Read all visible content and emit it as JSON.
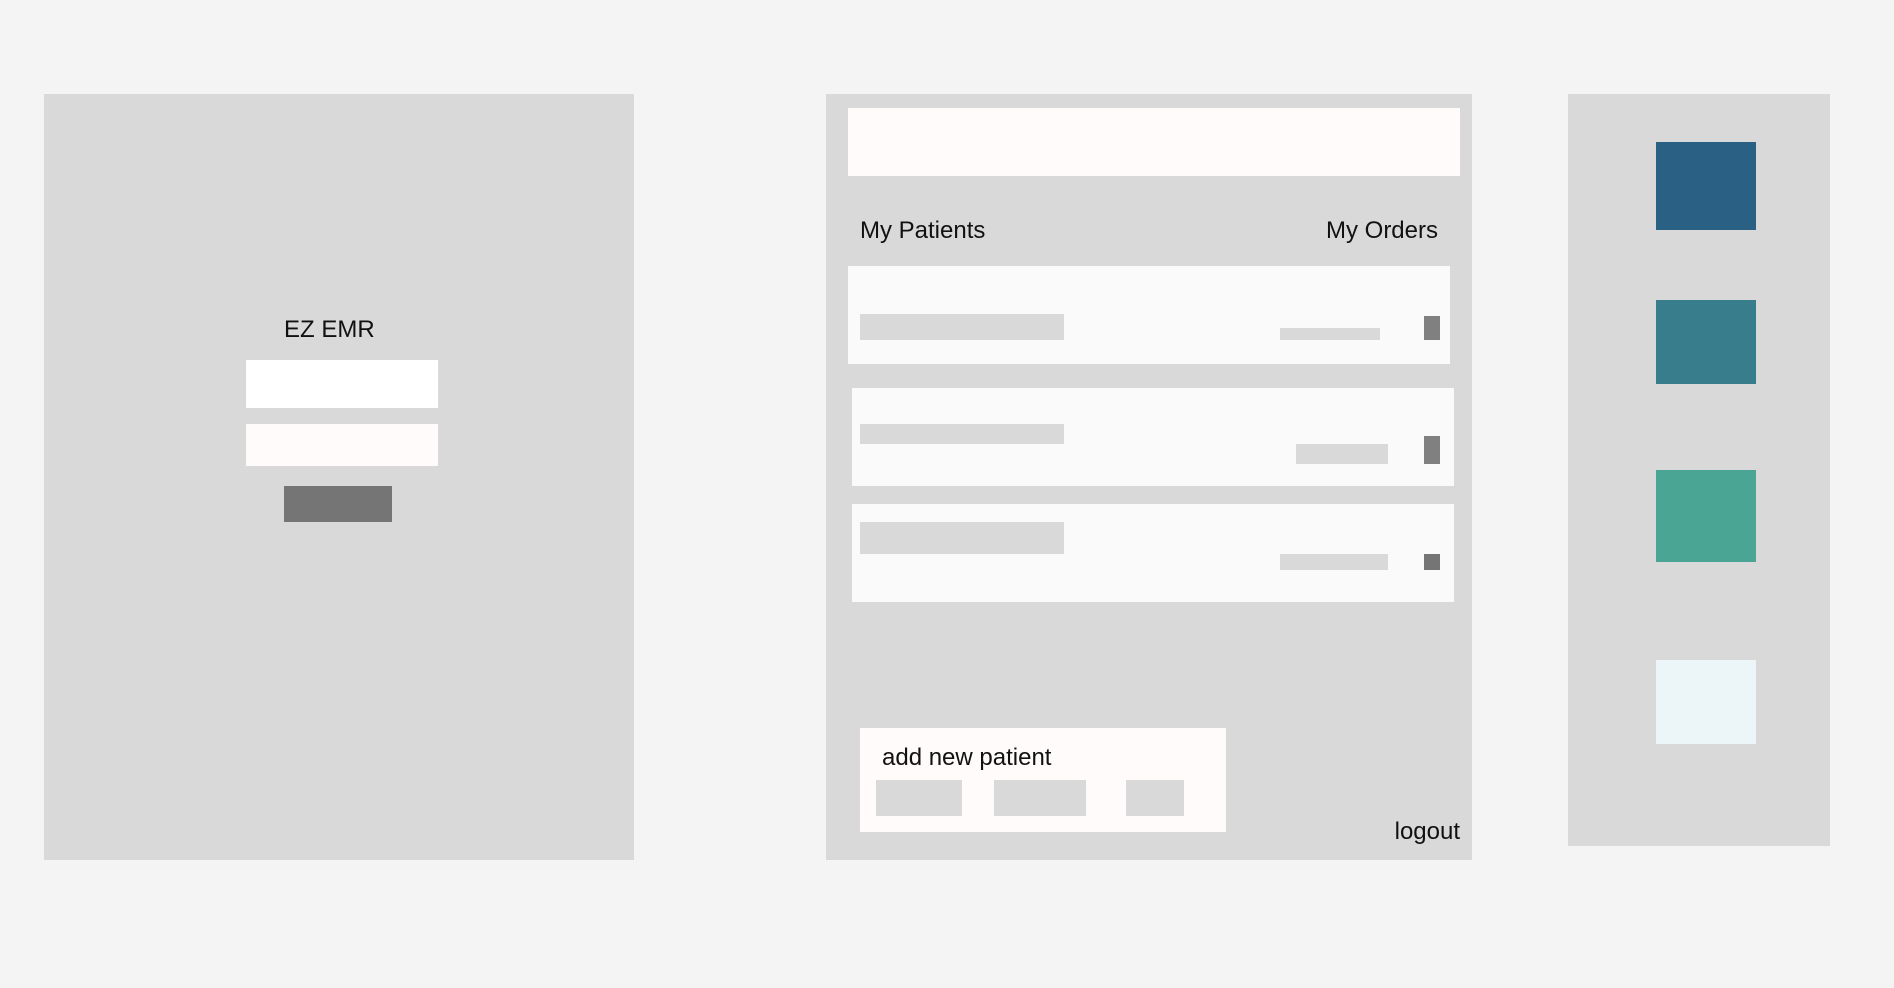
{
  "login": {
    "title": "EZ EMR"
  },
  "dashboard": {
    "tabs": {
      "patients": "My Patients",
      "orders": "My Orders"
    },
    "add_patient": {
      "title": "add new patient"
    },
    "logout_label": "logout"
  },
  "palette": {
    "swatches": [
      "#2a6083",
      "#387d8c",
      "#4aa594",
      "#ecf5f7"
    ]
  }
}
